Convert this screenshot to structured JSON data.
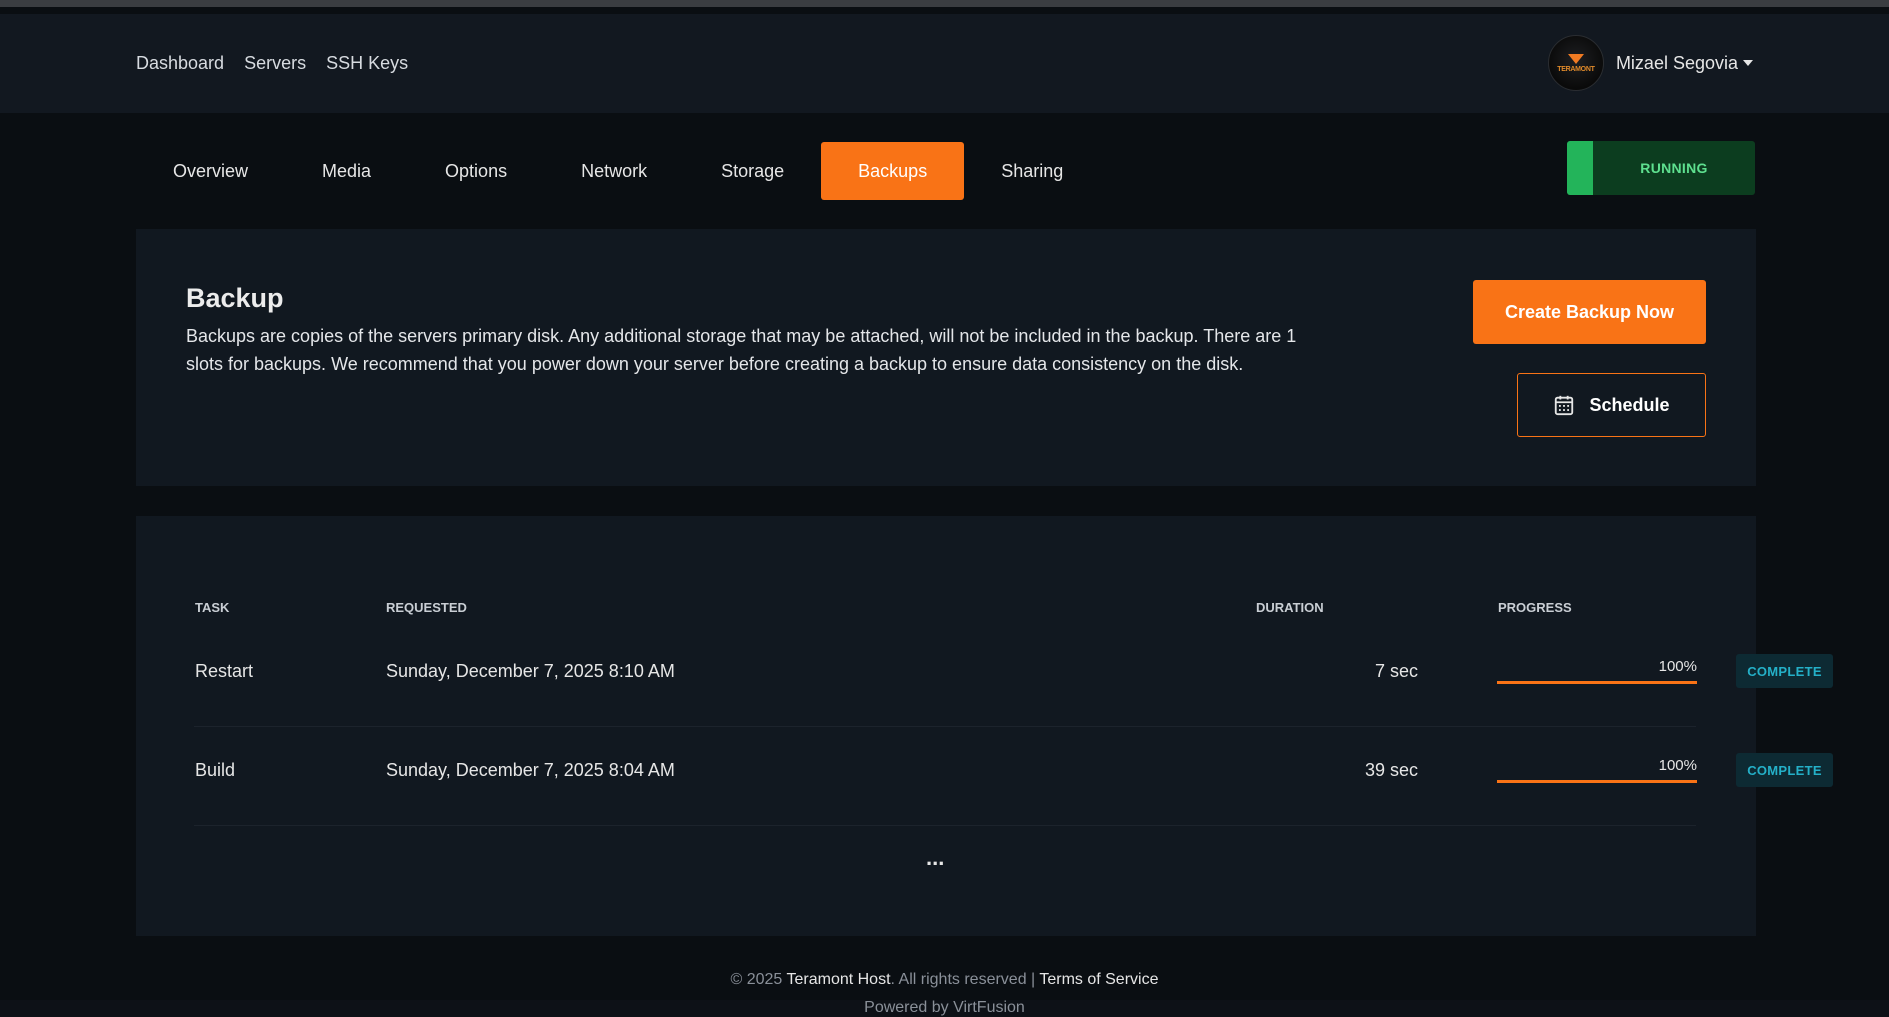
{
  "nav": {
    "links": [
      "Dashboard",
      "Servers",
      "SSH Keys"
    ],
    "user": {
      "name": "Mizael Segovia",
      "avatar_text": "TERAMONT"
    }
  },
  "tabs": [
    "Overview",
    "Media",
    "Options",
    "Network",
    "Storage",
    "Backups",
    "Sharing"
  ],
  "active_tab": "Backups",
  "server_status": "RUNNING",
  "backup": {
    "title": "Backup",
    "description": "Backups are copies of the servers primary disk. Any additional storage that may be attached, will not be included in the backup. There are 1 slots for backups. We recommend that you power down your server before creating a backup to ensure data consistency on the disk.",
    "create_button": "Create Backup Now",
    "schedule_button": "Schedule"
  },
  "table": {
    "headers": {
      "task": "TASK",
      "requested": "REQUESTED",
      "duration": "DURATION",
      "progress": "PROGRESS"
    },
    "rows": [
      {
        "task": "Restart",
        "requested": "Sunday, December 7, 2025 8:10 AM",
        "duration": "7 sec",
        "progress": "100%",
        "progress_value": 100,
        "status": "COMPLETE"
      },
      {
        "task": "Build",
        "requested": "Sunday, December 7, 2025 8:04 AM",
        "duration": "39 sec",
        "progress": "100%",
        "progress_value": 100,
        "status": "COMPLETE"
      }
    ],
    "more": "..."
  },
  "footer": {
    "copyright": "© 2025",
    "company": "Teramont Host",
    "rights": ". All rights reserved |",
    "terms": "Terms of Service",
    "powered": "Powered by VirtFusion"
  },
  "colors": {
    "accent": "#f97316",
    "running": "#23b45a",
    "complete": "#24b0c8"
  }
}
